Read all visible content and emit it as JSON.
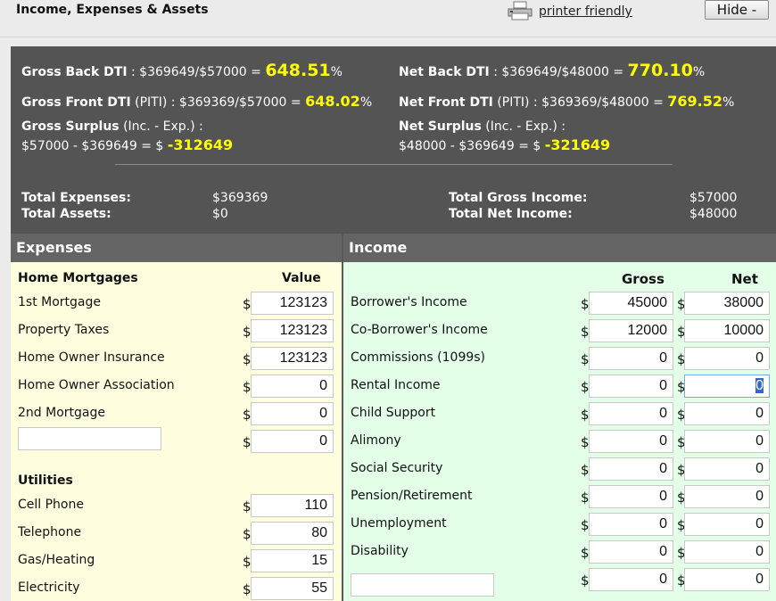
{
  "header": {
    "title": "Income, Expenses & Assets",
    "printer_label": "printer friendly",
    "hide_label": "Hide -"
  },
  "summary": {
    "gross_back": {
      "label": "Gross Back DTI",
      "formula": " : $369649/$57000 = ",
      "value": "648.51",
      "suffix": "%"
    },
    "net_back": {
      "label": "Net Back DTI",
      "formula": " : $369649/$48000 = ",
      "value": "770.10",
      "suffix": "%"
    },
    "gross_front": {
      "label": "Gross Front DTI",
      "note": " (PITI) : $369369/$57000 = ",
      "value": "648.02",
      "suffix": "%"
    },
    "net_front": {
      "label": "Net Front DTI",
      "note": " (PITI) : $369369/$48000 = ",
      "value": "769.52",
      "suffix": "%"
    },
    "gross_surplus": {
      "label": "Gross Surplus",
      "note": " (Inc. - Exp.) :",
      "formula": "$57000 - $369649 = $ ",
      "value": "-312649"
    },
    "net_surplus": {
      "label": "Net Surplus",
      "note": " (Inc. - Exp.) :",
      "formula": "$48000 - $369649 = $ ",
      "value": "-321649"
    },
    "total_expenses": {
      "label": "Total Expenses:",
      "value": "$369369"
    },
    "total_assets": {
      "label": "Total Assets:",
      "value": "$0"
    },
    "total_gross_income": {
      "label": "Total Gross Income:",
      "value": "$57000"
    },
    "total_net_income": {
      "label": "Total Net Income:",
      "value": "$48000"
    }
  },
  "expenses": {
    "title": "Expenses",
    "mortgage_section": "Home Mortgages",
    "value_header": "Value",
    "currency": "$",
    "mortgage_rows": [
      {
        "label": "1st Mortgage",
        "value": "123123"
      },
      {
        "label": "Property Taxes",
        "value": "123123"
      },
      {
        "label": "Home Owner Insurance",
        "value": "123123"
      },
      {
        "label": "Home Owner Association",
        "value": "0"
      },
      {
        "label": "2nd Mortgage",
        "value": "0"
      },
      {
        "label": "",
        "value": "0"
      }
    ],
    "utilities_section": "Utilities",
    "utility_rows": [
      {
        "label": "Cell Phone",
        "value": "110"
      },
      {
        "label": "Telephone",
        "value": "80"
      },
      {
        "label": "Gas/Heating",
        "value": "15"
      },
      {
        "label": "Electricity",
        "value": "55"
      }
    ]
  },
  "income": {
    "title": "Income",
    "gross_header": "Gross",
    "net_header": "Net",
    "currency": "$",
    "rows": [
      {
        "label": "Borrower's Income",
        "gross": "45000",
        "net": "38000"
      },
      {
        "label": "Co-Borrower's Income",
        "gross": "12000",
        "net": "10000"
      },
      {
        "label": "Commissions (1099s)",
        "gross": "0",
        "net": "0"
      },
      {
        "label": "Rental Income",
        "gross": "0",
        "net": "0"
      },
      {
        "label": "Child Support",
        "gross": "0",
        "net": "0"
      },
      {
        "label": "Alimony",
        "gross": "0",
        "net": "0"
      },
      {
        "label": "Social Security",
        "gross": "0",
        "net": "0"
      },
      {
        "label": "Pension/Retirement",
        "gross": "0",
        "net": "0"
      },
      {
        "label": "Unemployment",
        "gross": "0",
        "net": "0"
      },
      {
        "label": "Disability",
        "gross": "0",
        "net": "0"
      },
      {
        "label": "",
        "gross": "0",
        "net": "0"
      }
    ]
  },
  "colors": {
    "accent_yellow": "#ffff00",
    "summary_bg": "#545454",
    "expenses_bg": "#ffffe0",
    "income_bg": "#e3ffe8"
  },
  "icons": {
    "printer": "printer-icon"
  }
}
